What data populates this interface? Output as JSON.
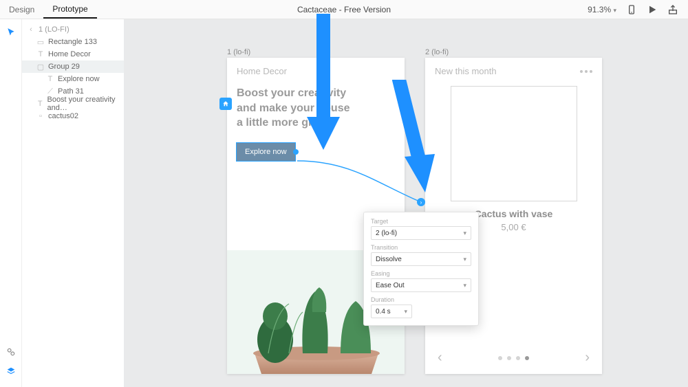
{
  "topbar": {
    "tabs": {
      "design": "Design",
      "prototype": "Prototype"
    },
    "title": "Cactaceae - Free Version",
    "zoom": "91.3%"
  },
  "layers": {
    "back": "1 (LO-FI)",
    "items": [
      {
        "label": "Rectangle 133",
        "glyph": "rect"
      },
      {
        "label": "Home Decor",
        "glyph": "text"
      },
      {
        "label": "Group 29",
        "glyph": "folder",
        "selected": true
      },
      {
        "label": "Explore now",
        "glyph": "text",
        "indent": 2
      },
      {
        "label": "Path 31",
        "glyph": "path",
        "indent": 2
      },
      {
        "label": "Boost your creativity and…",
        "glyph": "text"
      },
      {
        "label": "cactus02",
        "glyph": "image"
      }
    ]
  },
  "artboards": {
    "ab1": {
      "name": "1 (lo-fi)",
      "title": "Home Decor",
      "hero_line1": "Boost your creativity",
      "hero_line2": "and make your house",
      "hero_line3": "a little more green!",
      "cta": "Explore now"
    },
    "ab2": {
      "name": "2 (lo-fi)",
      "title": "New this month",
      "product_name": "Cactus with vase",
      "product_price": "5,00 €"
    }
  },
  "popover": {
    "target_label": "Target",
    "target_value": "2 (lo-fi)",
    "transition_label": "Transition",
    "transition_value": "Dissolve",
    "easing_label": "Easing",
    "easing_value": "Ease Out",
    "duration_label": "Duration",
    "duration_value": "0.4 s"
  }
}
